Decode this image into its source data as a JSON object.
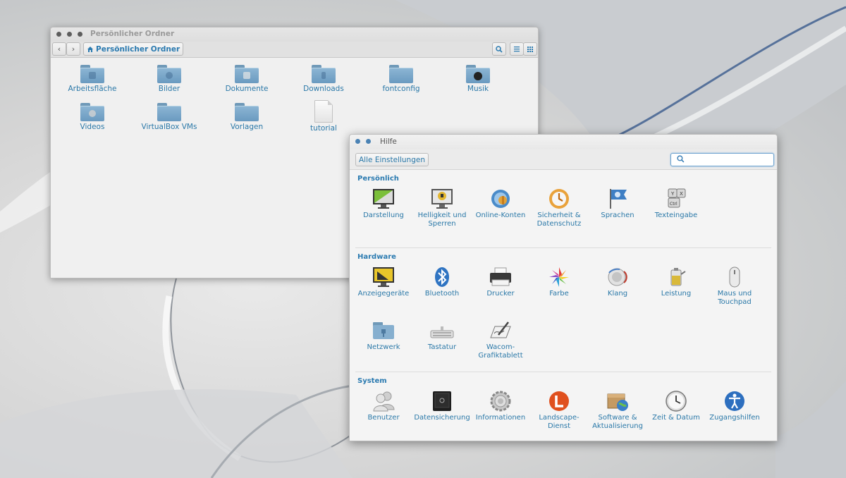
{
  "file_manager": {
    "title": "Persönlicher Ordner",
    "breadcrumb": "Persönlicher Ordner",
    "items": [
      {
        "label": "Arbeitsfläche",
        "icon": "folder-desktop-icon"
      },
      {
        "label": "Bilder",
        "icon": "folder-pictures-icon"
      },
      {
        "label": "Dokumente",
        "icon": "folder-documents-icon"
      },
      {
        "label": "Downloads",
        "icon": "folder-downloads-icon"
      },
      {
        "label": "fontconfig",
        "icon": "folder-icon"
      },
      {
        "label": "Musik",
        "icon": "folder-music-icon"
      },
      {
        "label": "Videos",
        "icon": "folder-videos-icon"
      },
      {
        "label": "VirtualBox VMs",
        "icon": "folder-icon"
      },
      {
        "label": "Vorlagen",
        "icon": "folder-templates-icon"
      },
      {
        "label": "tutorial",
        "icon": "text-file-icon"
      }
    ]
  },
  "settings": {
    "title": "Hilfe",
    "all_settings_label": "Alle Einstellungen",
    "search_placeholder": "",
    "sections": {
      "personal": {
        "heading": "Persönlich",
        "items": [
          "Darstellung",
          "Helligkeit und Sperren",
          "Online-Konten",
          "Sicherheit & Datenschutz",
          "Sprachen",
          "Texteingabe"
        ]
      },
      "hardware": {
        "heading": "Hardware",
        "items": [
          "Anzeigegeräte",
          "Bluetooth",
          "Drucker",
          "Farbe",
          "Klang",
          "Leistung",
          "Maus und Touchpad",
          "Netzwerk",
          "Tastatur",
          "Wacom-Grafiktablett"
        ]
      },
      "system": {
        "heading": "System",
        "items": [
          "Benutzer",
          "Datensicherung",
          "Informationen",
          "Landscape-Dienst",
          "Software & Aktualisierung",
          "Zeit & Datum",
          "Zugangshilfen"
        ]
      }
    }
  },
  "colors": {
    "accent": "#2a78a8",
    "folder": "#7aa7c9"
  }
}
